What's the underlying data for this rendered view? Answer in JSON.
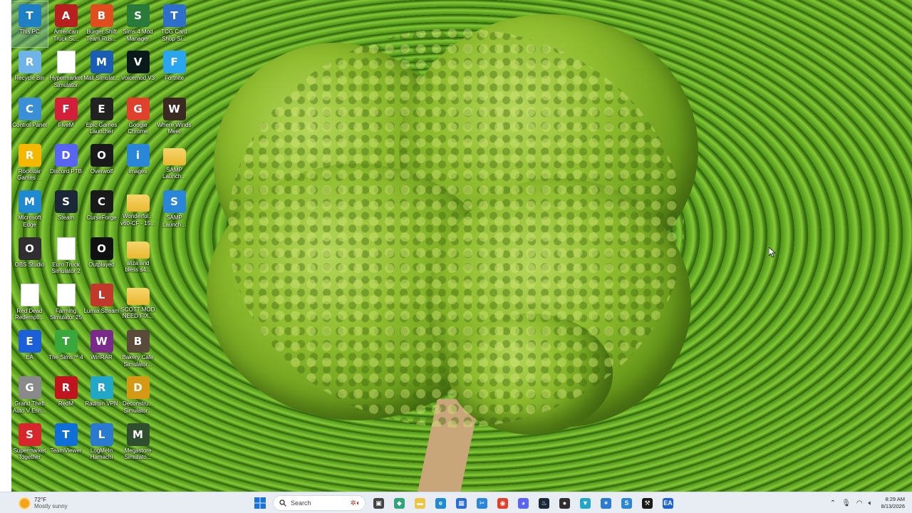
{
  "desktop_icons": [
    {
      "label": "This PC",
      "icon": "monitor-icon",
      "color": "#1f7fc4"
    },
    {
      "label": "American Truck Si...",
      "icon": "truck-icon",
      "color": "#b81f1f"
    },
    {
      "label": "Burger Shift Team Rus...",
      "icon": "burger-icon",
      "color": "#e04d1e"
    },
    {
      "label": "Sims 4 Mod Manager",
      "icon": "plumbob-icon",
      "color": "#2a7a3a"
    },
    {
      "label": "TCG Card Shop Si...",
      "icon": "cards-icon",
      "color": "#2e6fc9"
    },
    {
      "label": "Recycle Bin",
      "icon": "recycle-bin-icon",
      "color": "#6fb4e8"
    },
    {
      "label": "Hypermarket Simulator",
      "icon": "document-icon",
      "color": "#ffffff"
    },
    {
      "label": "Mall Simulat...",
      "icon": "mall-icon",
      "color": "#1a5db5"
    },
    {
      "label": "Voicemod V3",
      "icon": "voicemod-icon",
      "color": "#0a1a1a"
    },
    {
      "label": "Fortnite",
      "icon": "fortnite-icon",
      "color": "#2aa5f0"
    },
    {
      "label": "Control Panel",
      "icon": "control-panel-icon",
      "color": "#3b8fd6"
    },
    {
      "label": "FiveM",
      "icon": "fivem-icon",
      "color": "#d41f3a"
    },
    {
      "label": "Epic Games Launcher",
      "icon": "epic-games-icon",
      "color": "#222222"
    },
    {
      "label": "Google Chrome",
      "icon": "chrome-icon",
      "color": "#e0412c"
    },
    {
      "label": "Where Winds Meet",
      "icon": "wwm-icon",
      "color": "#3a2a22"
    },
    {
      "label": "Rockstar Games ...",
      "icon": "rockstar-icon",
      "color": "#f5b800"
    },
    {
      "label": "Discord PTB",
      "icon": "discord-icon",
      "color": "#5865f2"
    },
    {
      "label": "Overwolf",
      "icon": "overwolf-icon",
      "color": "#1a1a1a"
    },
    {
      "label": "images",
      "icon": "samp-icon",
      "color": "#2a87d8"
    },
    {
      "label": "SAMP Launch...",
      "icon": "folder-icon",
      "color": "#f0c443"
    },
    {
      "label": "Microsoft Edge",
      "icon": "edge-icon",
      "color": "#1f8ad2"
    },
    {
      "label": "Steam",
      "icon": "steam-icon",
      "color": "#1b2838"
    },
    {
      "label": "CurseForge",
      "icon": "curseforge-icon",
      "color": "#1a1a1a"
    },
    {
      "label": "Wonderful... v60-CF - 15...",
      "icon": "folder-icon",
      "color": "#f0c443"
    },
    {
      "label": "SAMP Launch...",
      "icon": "samp-icon",
      "color": "#2a87d8"
    },
    {
      "label": "OBS Studio",
      "icon": "obs-icon",
      "color": "#302e31"
    },
    {
      "label": "Euro Truck Simulator 2",
      "icon": "document-icon",
      "color": "#ffffff"
    },
    {
      "label": "Outplayed",
      "icon": "outplayed-icon",
      "color": "#111111"
    },
    {
      "label": "aliza and bless s4...",
      "icon": "folder-icon",
      "color": "#f0c443"
    },
    {
      "label": "",
      "icon": "",
      "color": ""
    },
    {
      "label": "Red Dead Redempti...",
      "icon": "document-icon",
      "color": "#ffffff"
    },
    {
      "label": "Farming Simulator 25",
      "icon": "document-icon",
      "color": "#ffffff"
    },
    {
      "label": "Lumia Stream",
      "icon": "lumia-icon",
      "color": "#c0392b"
    },
    {
      "label": "SCOTT MOD NEED FIX...",
      "icon": "folder-icon",
      "color": "#f0c443"
    },
    {
      "label": "",
      "icon": "",
      "color": ""
    },
    {
      "label": "EA",
      "icon": "ea-icon",
      "color": "#1b5fd9"
    },
    {
      "label": "The Sims™ 4",
      "icon": "sims-icon",
      "color": "#3aa83a"
    },
    {
      "label": "WinRAR",
      "icon": "winrar-icon",
      "color": "#7a2a8a"
    },
    {
      "label": "Bakery Cafe Simulator...",
      "icon": "bakery-icon",
      "color": "#5a4a3a"
    },
    {
      "label": "",
      "icon": "",
      "color": ""
    },
    {
      "label": "Grand Theft Auto V Enh...",
      "icon": "gta-icon",
      "color": "#8a8a8a"
    },
    {
      "label": "RedM",
      "icon": "redm-icon",
      "color": "#c0141e"
    },
    {
      "label": "Radmin VPN",
      "icon": "radmin-icon",
      "color": "#22a7c9"
    },
    {
      "label": "Deconstru... Simulator...",
      "icon": "deconstruction-icon",
      "color": "#d49a14"
    },
    {
      "label": "",
      "icon": "",
      "color": ""
    },
    {
      "label": "Supermarket Together",
      "icon": "supermarket-icon",
      "color": "#d7262c"
    },
    {
      "label": "TeamViewer",
      "icon": "teamviewer-icon",
      "color": "#0e6fd6"
    },
    {
      "label": "LogMeIn Hamachi",
      "icon": "hamachi-icon",
      "color": "#2a7ad0"
    },
    {
      "label": "Megastore Simulato...",
      "icon": "megastore-icon",
      "color": "#2f4f2f"
    },
    {
      "label": "",
      "icon": "",
      "color": ""
    }
  ],
  "taskbar": {
    "weather": {
      "temp": "72°F",
      "condition": "Mostly sunny"
    },
    "search_placeholder": "Search",
    "pinned": [
      {
        "name": "task-view",
        "icon": "task-view-icon",
        "color": "#444444",
        "glyph": "▣"
      },
      {
        "name": "copilot",
        "icon": "copilot-icon",
        "color": "#2fa37a",
        "glyph": "◆"
      },
      {
        "name": "file-explorer",
        "icon": "folder-icon",
        "color": "#f0c443",
        "glyph": "▬"
      },
      {
        "name": "edge",
        "icon": "edge-icon",
        "color": "#1f8ad2",
        "glyph": "e"
      },
      {
        "name": "store",
        "icon": "store-icon",
        "color": "#2a6dd6",
        "glyph": "▦"
      },
      {
        "name": "snipping",
        "icon": "snipping-icon",
        "color": "#2a87d8",
        "glyph": "✂"
      },
      {
        "name": "chrome",
        "icon": "chrome-icon",
        "color": "#e0412c",
        "glyph": "◉"
      },
      {
        "name": "discord",
        "icon": "discord-icon",
        "color": "#5865f2",
        "glyph": "◕"
      },
      {
        "name": "steam",
        "icon": "steam-icon",
        "color": "#1b2838",
        "glyph": "♨"
      },
      {
        "name": "obs",
        "icon": "obs-icon",
        "color": "#302e31",
        "glyph": "●"
      },
      {
        "name": "radmin",
        "icon": "radmin-icon",
        "color": "#22a7c9",
        "glyph": "▼"
      },
      {
        "name": "hamachi",
        "icon": "hamachi-icon",
        "color": "#2a7ad0",
        "glyph": "✶"
      },
      {
        "name": "samp",
        "icon": "samp-icon",
        "color": "#2a87d8",
        "glyph": "S"
      },
      {
        "name": "curseforge",
        "icon": "curseforge-icon",
        "color": "#1a1a1a",
        "glyph": "⚒"
      },
      {
        "name": "ea",
        "icon": "ea-icon",
        "color": "#1b5fd9",
        "glyph": "EA"
      }
    ],
    "tray": {
      "time": "8:29 AM",
      "date": "8/13/2026"
    }
  }
}
